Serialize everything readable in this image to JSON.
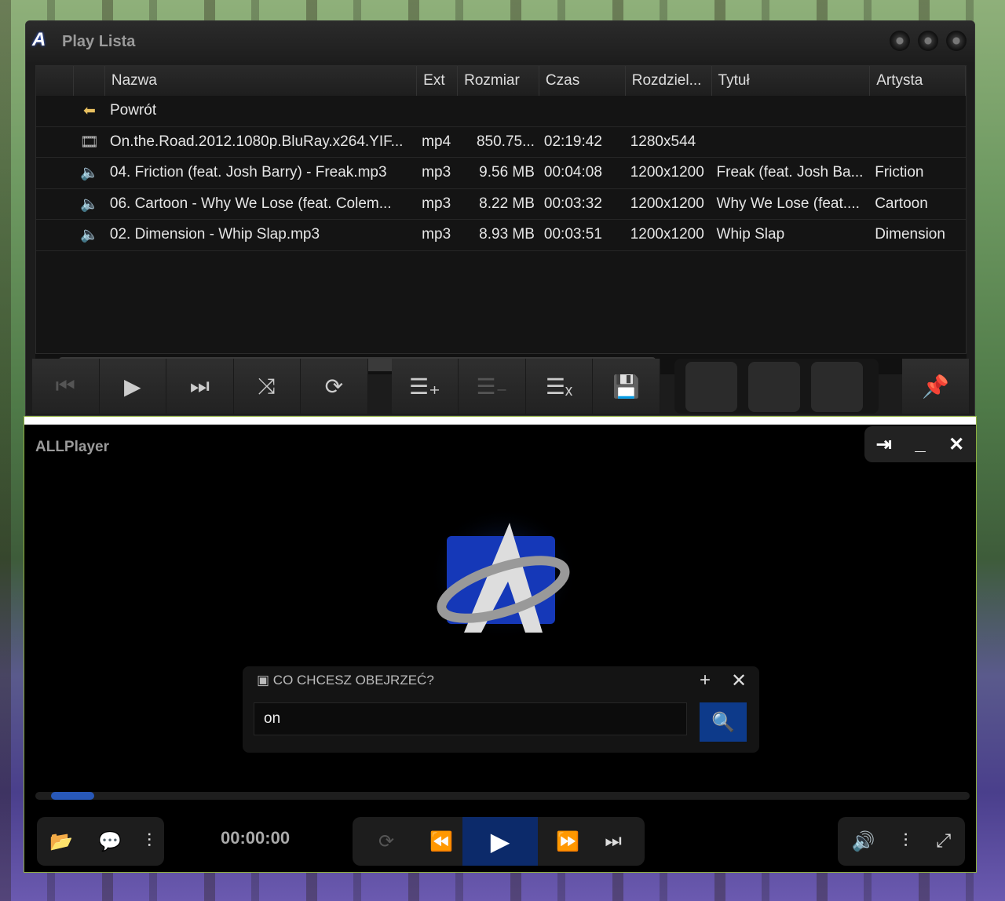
{
  "playlist": {
    "title": "Play Lista",
    "columns": [
      "",
      "",
      "Nazwa",
      "Ext",
      "Rozmiar",
      "Czas",
      "Rozdziel...",
      "Tytuł",
      "Artysta"
    ],
    "back_label": "Powrót",
    "rows": [
      {
        "icon": "video-icon",
        "name": "On.the.Road.2012.1080p.BluRay.x264.YIF...",
        "ext": "mp4",
        "size": "850.75...",
        "time": "02:19:42",
        "res": "1280x544",
        "title": "",
        "artist": ""
      },
      {
        "icon": "audio-icon",
        "name": "04. Friction (feat. Josh Barry) - Freak.mp3",
        "ext": "mp3",
        "size": "9.56 MB",
        "time": "00:04:08",
        "res": "1200x1200",
        "title": "Freak (feat. Josh Ba...",
        "artist": "Friction"
      },
      {
        "icon": "audio-icon",
        "name": "06. Cartoon - Why We Lose (feat. Colem...",
        "ext": "mp3",
        "size": "8.22 MB",
        "time": "00:03:32",
        "res": "1200x1200",
        "title": "Why We Lose (feat....",
        "artist": "Cartoon"
      },
      {
        "icon": "audio-icon",
        "name": "02. Dimension - Whip Slap.mp3",
        "ext": "mp3",
        "size": "8.93 MB",
        "time": "00:03:51",
        "res": "1200x1200",
        "title": "Whip Slap",
        "artist": "Dimension"
      }
    ]
  },
  "player": {
    "title": "ALLPlayer",
    "logo_text": "A",
    "search_label": "CO CHCESZ OBEJRZEĆ?",
    "search_value": "on",
    "time": "00:00:00",
    "progress_percent": 4.6
  }
}
